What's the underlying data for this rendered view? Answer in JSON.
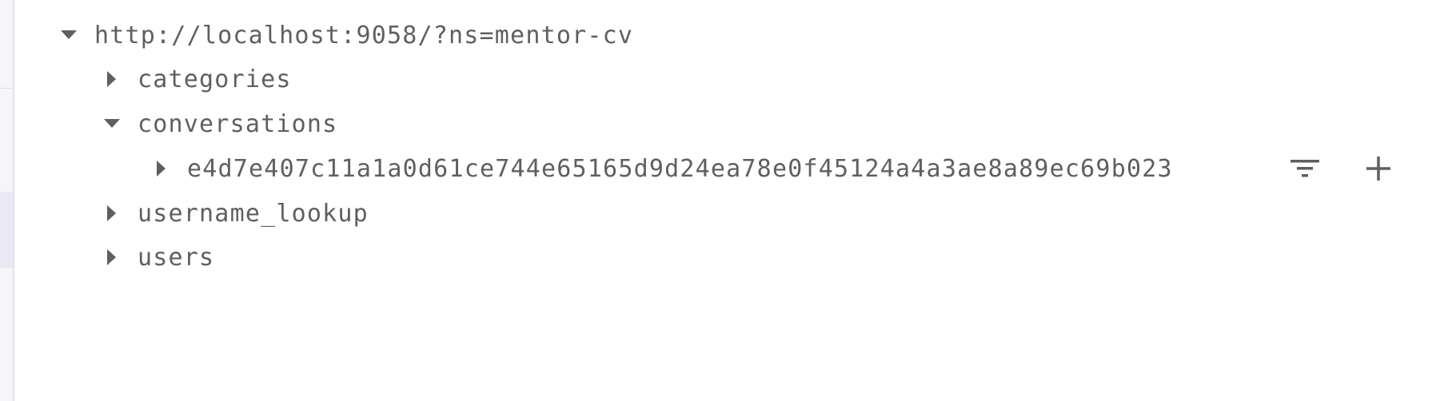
{
  "tree": {
    "root": {
      "label": "http://localhost:9058/?ns=mentor-cv",
      "expanded": true,
      "icon": "caret-down-icon"
    },
    "children": [
      {
        "label": "categories",
        "expanded": false,
        "icon": "caret-right-icon"
      },
      {
        "label": "conversations",
        "expanded": true,
        "icon": "caret-down-icon",
        "children": [
          {
            "label": "e4d7e407c11a1a0d61ce744e65165d9d24ea78e0f45124a4a3ae8a89ec69b023",
            "expanded": false,
            "icon": "caret-right-icon"
          }
        ]
      },
      {
        "label": "username_lookup",
        "expanded": false,
        "icon": "caret-right-icon"
      },
      {
        "label": "users",
        "expanded": false,
        "icon": "caret-right-icon"
      }
    ]
  },
  "row_actions": {
    "filter_icon": "filter-icon",
    "add_icon": "add-icon"
  },
  "colors": {
    "text": "#5f5f5f",
    "icon": "#5f5f5f",
    "sidebar_bg": "#f6f6f8",
    "sidebar_highlight": "#ebe8f6"
  }
}
